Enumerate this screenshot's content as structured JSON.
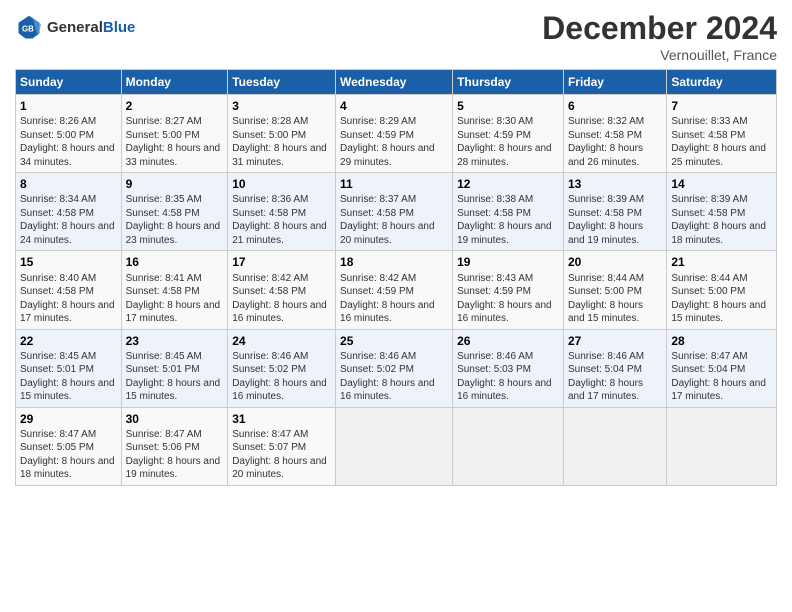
{
  "header": {
    "logo_line1": "General",
    "logo_line2": "Blue",
    "month": "December 2024",
    "location": "Vernouillet, France"
  },
  "days_of_week": [
    "Sunday",
    "Monday",
    "Tuesday",
    "Wednesday",
    "Thursday",
    "Friday",
    "Saturday"
  ],
  "weeks": [
    [
      {
        "day": "1",
        "sunrise": "8:26 AM",
        "sunset": "5:00 PM",
        "daylight": "8 hours and 34 minutes."
      },
      {
        "day": "2",
        "sunrise": "8:27 AM",
        "sunset": "5:00 PM",
        "daylight": "8 hours and 33 minutes."
      },
      {
        "day": "3",
        "sunrise": "8:28 AM",
        "sunset": "5:00 PM",
        "daylight": "8 hours and 31 minutes."
      },
      {
        "day": "4",
        "sunrise": "8:29 AM",
        "sunset": "4:59 PM",
        "daylight": "8 hours and 29 minutes."
      },
      {
        "day": "5",
        "sunrise": "8:30 AM",
        "sunset": "4:59 PM",
        "daylight": "8 hours and 28 minutes."
      },
      {
        "day": "6",
        "sunrise": "8:32 AM",
        "sunset": "4:58 PM",
        "daylight": "8 hours and 26 minutes."
      },
      {
        "day": "7",
        "sunrise": "8:33 AM",
        "sunset": "4:58 PM",
        "daylight": "8 hours and 25 minutes."
      }
    ],
    [
      {
        "day": "8",
        "sunrise": "8:34 AM",
        "sunset": "4:58 PM",
        "daylight": "8 hours and 24 minutes."
      },
      {
        "day": "9",
        "sunrise": "8:35 AM",
        "sunset": "4:58 PM",
        "daylight": "8 hours and 23 minutes."
      },
      {
        "day": "10",
        "sunrise": "8:36 AM",
        "sunset": "4:58 PM",
        "daylight": "8 hours and 21 minutes."
      },
      {
        "day": "11",
        "sunrise": "8:37 AM",
        "sunset": "4:58 PM",
        "daylight": "8 hours and 20 minutes."
      },
      {
        "day": "12",
        "sunrise": "8:38 AM",
        "sunset": "4:58 PM",
        "daylight": "8 hours and 19 minutes."
      },
      {
        "day": "13",
        "sunrise": "8:39 AM",
        "sunset": "4:58 PM",
        "daylight": "8 hours and 19 minutes."
      },
      {
        "day": "14",
        "sunrise": "8:39 AM",
        "sunset": "4:58 PM",
        "daylight": "8 hours and 18 minutes."
      }
    ],
    [
      {
        "day": "15",
        "sunrise": "8:40 AM",
        "sunset": "4:58 PM",
        "daylight": "8 hours and 17 minutes."
      },
      {
        "day": "16",
        "sunrise": "8:41 AM",
        "sunset": "4:58 PM",
        "daylight": "8 hours and 17 minutes."
      },
      {
        "day": "17",
        "sunrise": "8:42 AM",
        "sunset": "4:58 PM",
        "daylight": "8 hours and 16 minutes."
      },
      {
        "day": "18",
        "sunrise": "8:42 AM",
        "sunset": "4:59 PM",
        "daylight": "8 hours and 16 minutes."
      },
      {
        "day": "19",
        "sunrise": "8:43 AM",
        "sunset": "4:59 PM",
        "daylight": "8 hours and 16 minutes."
      },
      {
        "day": "20",
        "sunrise": "8:44 AM",
        "sunset": "5:00 PM",
        "daylight": "8 hours and 15 minutes."
      },
      {
        "day": "21",
        "sunrise": "8:44 AM",
        "sunset": "5:00 PM",
        "daylight": "8 hours and 15 minutes."
      }
    ],
    [
      {
        "day": "22",
        "sunrise": "8:45 AM",
        "sunset": "5:01 PM",
        "daylight": "8 hours and 15 minutes."
      },
      {
        "day": "23",
        "sunrise": "8:45 AM",
        "sunset": "5:01 PM",
        "daylight": "8 hours and 15 minutes."
      },
      {
        "day": "24",
        "sunrise": "8:46 AM",
        "sunset": "5:02 PM",
        "daylight": "8 hours and 16 minutes."
      },
      {
        "day": "25",
        "sunrise": "8:46 AM",
        "sunset": "5:02 PM",
        "daylight": "8 hours and 16 minutes."
      },
      {
        "day": "26",
        "sunrise": "8:46 AM",
        "sunset": "5:03 PM",
        "daylight": "8 hours and 16 minutes."
      },
      {
        "day": "27",
        "sunrise": "8:46 AM",
        "sunset": "5:04 PM",
        "daylight": "8 hours and 17 minutes."
      },
      {
        "day": "28",
        "sunrise": "8:47 AM",
        "sunset": "5:04 PM",
        "daylight": "8 hours and 17 minutes."
      }
    ],
    [
      {
        "day": "29",
        "sunrise": "8:47 AM",
        "sunset": "5:05 PM",
        "daylight": "8 hours and 18 minutes."
      },
      {
        "day": "30",
        "sunrise": "8:47 AM",
        "sunset": "5:06 PM",
        "daylight": "8 hours and 19 minutes."
      },
      {
        "day": "31",
        "sunrise": "8:47 AM",
        "sunset": "5:07 PM",
        "daylight": "8 hours and 20 minutes."
      },
      null,
      null,
      null,
      null
    ]
  ]
}
